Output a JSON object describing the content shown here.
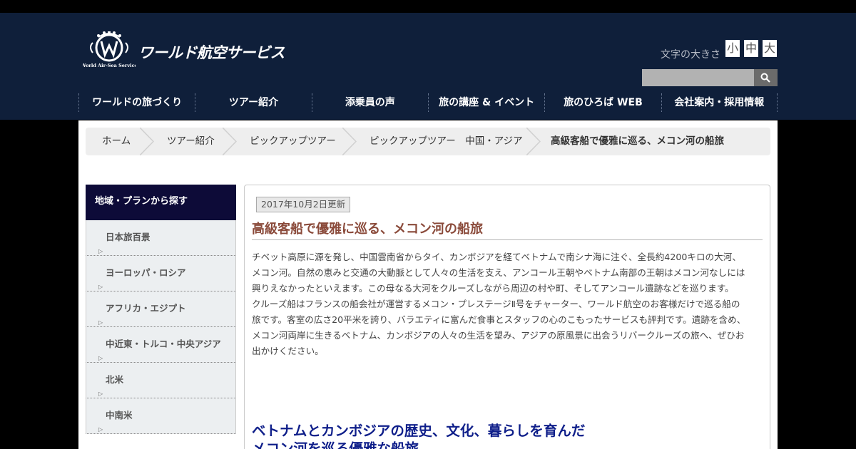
{
  "header": {
    "logo_text": "ワールド航空サービス",
    "logo_caption": "World Air-Sea Service",
    "fontsize_label": "文字の大きさ",
    "fontsize_small": "小",
    "fontsize_mid": "中",
    "fontsize_large": "大",
    "search_placeholder": "",
    "colors": {
      "header_bg": "#0f1f3a",
      "sidebar_head_bg": "#0d0b38",
      "title_color": "#8a4a3a",
      "subtitle_color": "#0f1f8a"
    }
  },
  "gnav": [
    {
      "label": "ワールドの旅づくり"
    },
    {
      "label": "ツアー紹介"
    },
    {
      "label": "添乗員の声"
    },
    {
      "label": "旅の講座 & イベント"
    },
    {
      "label": "旅のひろば WEB"
    },
    {
      "label": "会社案内・採用情報"
    }
  ],
  "breadcrumb": [
    {
      "label": "ホーム"
    },
    {
      "label": "ツアー紹介"
    },
    {
      "label": "ピックアップツアー"
    },
    {
      "label": "ピックアップツアー　中国・アジア"
    },
    {
      "label": "高級客船で優雅に巡る、メコン河の船旅"
    }
  ],
  "sidebar": {
    "heading": "地域・プランから探す",
    "items": [
      {
        "label": "日本旅百景"
      },
      {
        "label": "ヨーロッパ・ロシア"
      },
      {
        "label": "アフリカ・エジプト"
      },
      {
        "label": "中近東・トルコ・中央アジア"
      },
      {
        "label": "北米"
      },
      {
        "label": "中南米"
      }
    ]
  },
  "article": {
    "date": "2017年10月2日更新",
    "title": "高級客船で優雅に巡る、メコン河の船旅",
    "body_lines": [
      "チベット高原に源を発し、中国雲南省からタイ、カンボジアを経てベトナムで南シナ海に注ぐ、全長約4200キロの大河、",
      "メコン河。自然の恵みと交通の大動脈として人々の生活を支え、アンコール王朝やベトナム南部の王朝はメコン河なしには",
      "興りえなかったといえます。この母なる大河をクルーズしながら周辺の村や町、そしてアンコール遺跡などを巡ります。",
      "クルーズ船はフランスの船会社が運営するメコン・プレステージⅡ号をチャーター、ワールド航空のお客様だけで巡る船の",
      "旅です。客室の広さ20平米を誇り、バラエティに富んだ食事とスタッフの心のこもったサービスも評判です。遺跡を含め、",
      "メコン河両岸に生きるベトナム、カンボジアの人々の生活を望み、アジアの原風景に出会うリバークルーズの旅へ、ぜひお",
      "出かけください。"
    ],
    "subtitle_line1": "ベトナムとカンボジアの歴史、文化、暮らしを育んだ",
    "subtitle_line2": "メコン河を巡る優雅な船旅"
  },
  "icons": {
    "search": "search-icon",
    "logo": "logo-emblem-icon",
    "breadcrumb_separator": "chevron-right-icon",
    "sidebar_bullet": "triangle-right-icon"
  }
}
